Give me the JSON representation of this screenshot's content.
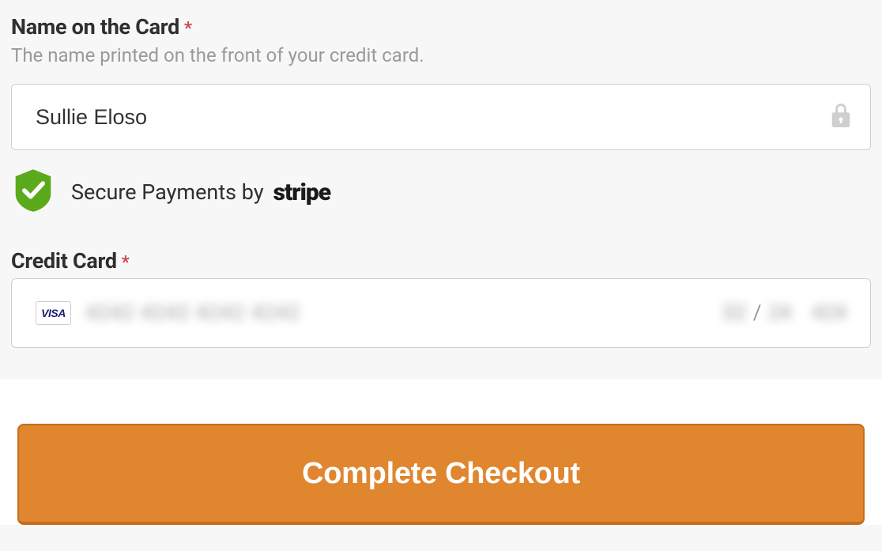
{
  "nameField": {
    "label": "Name on the Card",
    "help": "The name printed on the front of your credit card.",
    "value": "Sullie Eloso"
  },
  "secure": {
    "text": "Secure Payments by",
    "provider": "stripe"
  },
  "cardField": {
    "label": "Credit Card",
    "brand": "VISA",
    "masked_number": "4242 4242 4242 4242",
    "exp_mm": "02",
    "exp_yy": "24",
    "cvc": "424"
  },
  "submit": {
    "label": "Complete Checkout"
  },
  "colors": {
    "accent": "#e0862f",
    "shield": "#5aaa1b"
  }
}
